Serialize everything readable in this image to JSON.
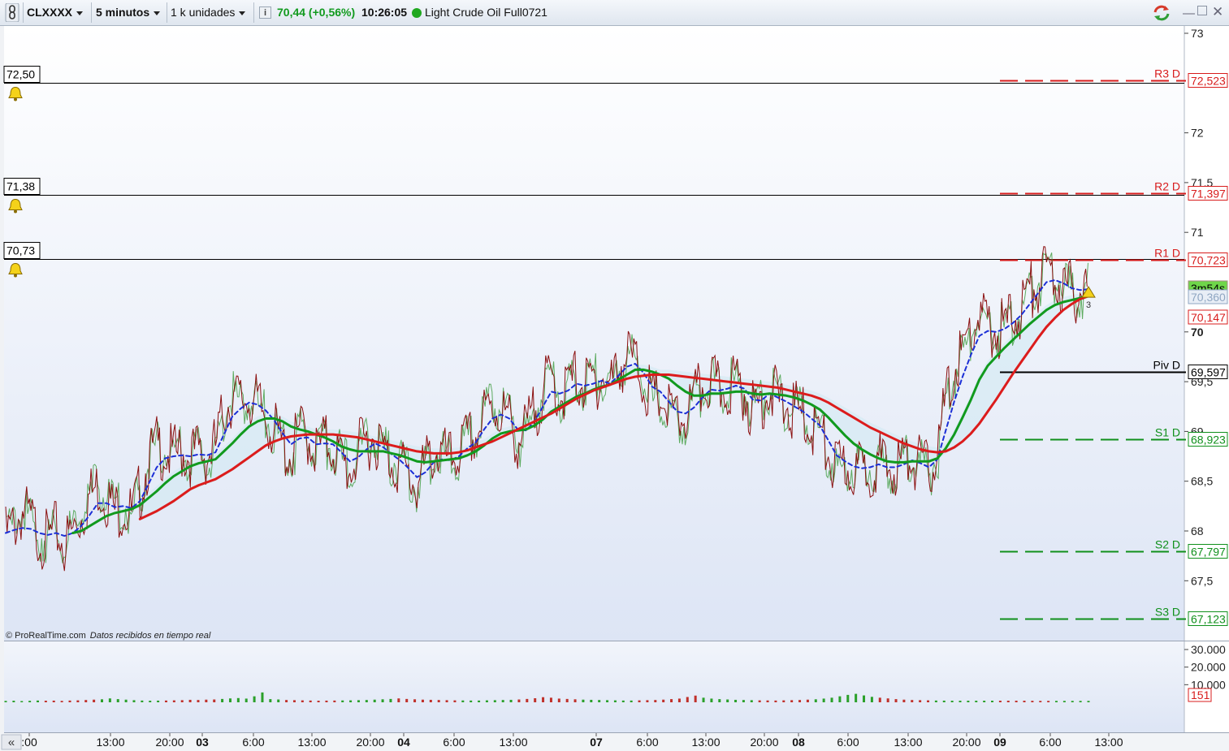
{
  "toolbar": {
    "symbol": "CLXXXX",
    "timeframe": "5 minutos",
    "units": "1 k unidades",
    "price": "70,44 (+0,56%)",
    "time": "10:26:05",
    "instrument": "Light Crude Oil Full0721"
  },
  "copyright": "© ProRealTime.com",
  "copyright_note": "Datos recibidos en tiempo real",
  "colors": {
    "price_line": "#8b1010",
    "fast_ma": "#1c2fd6",
    "medium_ma": "#119a1e",
    "slow_ma": "#dc1c1c",
    "resistance": "#d81c1c",
    "support": "#10901c",
    "pivot": "#000000",
    "background_top": "#ffffff",
    "background_bottom": "#dde5f5"
  },
  "icons": [
    "chain-link-icon",
    "info-icon",
    "status-dot-icon",
    "refresh-icon",
    "minimize-icon",
    "maximize-icon",
    "close-icon",
    "alert-bell-icon",
    "scroll-left-icon"
  ],
  "chart_data": {
    "type": "line",
    "title": "Light Crude Oil Full0721",
    "xlabel": "",
    "ylabel": "",
    "ylim": [
      66.7,
      73.1
    ],
    "grid": false,
    "y_ticks": [
      "73",
      "72",
      "71,5",
      "71",
      "70",
      "69,5",
      "69",
      "68,5",
      "68",
      "67,5"
    ],
    "x_ticks": [
      ":00",
      "13:00",
      "20:00",
      "03",
      "6:00",
      "13:00",
      "20:00",
      "04",
      "6:00",
      "13:00",
      "07",
      "6:00",
      "13:00",
      "20:00",
      "08",
      "6:00",
      "13:00",
      "20:00",
      "09",
      "6:00",
      "13:00"
    ],
    "x_ticks_bold": [
      "03",
      "04",
      "07",
      "08",
      "09"
    ],
    "series": [
      {
        "values": [
          67.95,
          68.05,
          68.2,
          68.1,
          67.95,
          67.9,
          68.0,
          67.85,
          68.0,
          68.15,
          68.35,
          68.45,
          68.35,
          68.2,
          68.25,
          68.15,
          68.4,
          68.7,
          68.85,
          68.8,
          68.75,
          68.8,
          68.75,
          68.8,
          68.75,
          68.85,
          69.2,
          69.35,
          69.3,
          69.35,
          69.25,
          69.15,
          69.0,
          68.85,
          68.75,
          69.0,
          68.95,
          68.8,
          68.9,
          68.85,
          68.7,
          68.6,
          68.8,
          68.9,
          68.95,
          68.8,
          68.7,
          68.65,
          68.55,
          68.45,
          68.65,
          68.8,
          68.75,
          68.7,
          68.8,
          68.9,
          68.95,
          69.15,
          69.25,
          69.2,
          69.1,
          68.9,
          69.0,
          69.2,
          69.4,
          69.55,
          69.35,
          69.45,
          69.55,
          69.45,
          69.5,
          69.55,
          69.45,
          69.65,
          69.75,
          69.7,
          69.5,
          69.3,
          69.35,
          69.2,
          69.1,
          69.15,
          69.3,
          69.45,
          69.5,
          69.4,
          69.45,
          69.5,
          69.4,
          69.2,
          69.3,
          69.45,
          69.3,
          69.25,
          69.2,
          69.15,
          69.05,
          69.0,
          68.75,
          68.6,
          68.65,
          68.6,
          68.6,
          68.65,
          68.7,
          68.6,
          68.65,
          68.7,
          68.75,
          68.65,
          68.6,
          68.8,
          69.3,
          69.6,
          69.8,
          70.0,
          70.15,
          70.05,
          70.0,
          70.05,
          70.15,
          70.25,
          70.4,
          70.5,
          70.6,
          70.55,
          70.45,
          70.4,
          70.4,
          70.45
        ]
      },
      {
        "values": [
          67.98,
          68.01,
          68.03,
          68.02,
          67.98,
          67.96,
          67.98,
          67.95,
          67.98,
          68.05,
          68.16,
          68.28,
          68.28,
          68.24,
          68.25,
          68.23,
          68.3,
          68.47,
          68.64,
          68.73,
          68.75,
          68.76,
          68.75,
          68.77,
          68.76,
          68.79,
          68.97,
          69.15,
          69.23,
          69.29,
          69.27,
          69.21,
          69.11,
          68.98,
          68.87,
          68.93,
          68.94,
          68.87,
          68.88,
          68.87,
          68.79,
          68.7,
          68.74,
          68.82,
          68.88,
          68.84,
          68.77,
          68.71,
          68.63,
          68.54,
          68.59,
          68.69,
          68.72,
          68.71,
          68.75,
          68.83,
          68.89,
          69.02,
          69.13,
          69.17,
          69.13,
          69.02,
          69.01,
          69.1,
          69.25,
          69.4,
          69.38,
          69.41,
          69.48,
          69.46,
          69.48,
          69.51,
          69.48,
          69.56,
          69.65,
          69.68,
          69.59,
          69.45,
          69.4,
          69.3,
          69.2,
          69.18,
          69.24,
          69.34,
          69.42,
          69.41,
          69.43,
          69.46,
          69.43,
          69.32,
          69.31,
          69.38,
          69.34,
          69.3,
          69.25,
          69.2,
          69.13,
          69.06,
          68.91,
          68.76,
          68.7,
          68.65,
          68.63,
          68.64,
          68.67,
          68.64,
          68.64,
          68.67,
          68.71,
          68.68,
          68.64,
          68.72,
          69.01,
          69.3,
          69.55,
          69.77,
          69.96,
          70.01,
          70.0,
          70.03,
          70.09,
          70.17,
          70.28,
          70.39,
          70.5,
          70.52,
          70.49,
          70.44,
          70.42,
          70.43
        ]
      },
      {
        "values": [
          null,
          null,
          null,
          null,
          null,
          null,
          null,
          null,
          67.98,
          68.0,
          68.05,
          68.1,
          68.15,
          68.18,
          68.2,
          68.22,
          68.26,
          68.33,
          68.4,
          68.48,
          68.55,
          68.6,
          68.65,
          68.68,
          68.7,
          68.72,
          68.8,
          68.88,
          68.97,
          69.05,
          69.1,
          69.13,
          69.13,
          69.1,
          69.05,
          69.02,
          69.0,
          68.97,
          68.94,
          68.9,
          68.85,
          68.82,
          68.8,
          68.8,
          68.8,
          68.8,
          68.78,
          68.76,
          68.73,
          68.7,
          68.69,
          68.7,
          68.71,
          68.72,
          68.73,
          68.76,
          68.8,
          68.86,
          68.93,
          68.98,
          69.0,
          69.01,
          69.02,
          69.06,
          69.12,
          69.2,
          69.25,
          69.3,
          69.35,
          69.38,
          69.42,
          69.45,
          69.47,
          69.52,
          69.57,
          69.62,
          69.62,
          69.6,
          69.57,
          69.53,
          69.46,
          69.4,
          69.36,
          69.36,
          69.38,
          69.38,
          69.39,
          69.4,
          69.4,
          69.38,
          69.37,
          69.38,
          69.37,
          69.36,
          69.34,
          69.31,
          69.27,
          69.22,
          69.14,
          69.05,
          68.96,
          68.88,
          68.82,
          68.77,
          68.73,
          68.7,
          68.69,
          68.69,
          68.7,
          68.7,
          68.7,
          68.73,
          68.83,
          68.97,
          69.14,
          69.32,
          69.52,
          69.66,
          69.75,
          69.84,
          69.92,
          70.0,
          70.08,
          70.15,
          70.22,
          70.27,
          70.3,
          70.32,
          70.34,
          70.36
        ]
      },
      {
        "values": [
          null,
          null,
          null,
          null,
          null,
          null,
          null,
          null,
          null,
          null,
          null,
          null,
          null,
          null,
          null,
          null,
          68.12,
          68.16,
          68.2,
          68.25,
          68.3,
          68.36,
          68.42,
          68.46,
          68.49,
          68.52,
          68.57,
          68.62,
          68.68,
          68.74,
          68.8,
          68.86,
          68.9,
          68.93,
          68.95,
          68.96,
          68.97,
          68.97,
          68.97,
          68.97,
          68.96,
          68.95,
          68.94,
          68.92,
          68.9,
          68.88,
          68.86,
          68.84,
          68.82,
          68.8,
          68.79,
          68.78,
          68.78,
          68.78,
          68.79,
          68.81,
          68.84,
          68.87,
          68.9,
          68.94,
          68.98,
          69.02,
          69.06,
          69.1,
          69.14,
          69.18,
          69.23,
          69.28,
          69.33,
          69.37,
          69.41,
          69.44,
          69.47,
          69.5,
          69.53,
          69.55,
          69.56,
          69.57,
          69.57,
          69.57,
          69.56,
          69.55,
          69.54,
          69.53,
          69.52,
          69.51,
          69.5,
          69.49,
          69.48,
          69.47,
          69.46,
          69.45,
          69.44,
          69.42,
          69.4,
          69.38,
          69.36,
          69.33,
          69.29,
          69.24,
          69.19,
          69.14,
          69.09,
          69.04,
          69.0,
          68.96,
          68.92,
          68.88,
          68.85,
          68.82,
          68.8,
          68.79,
          68.8,
          68.84,
          68.9,
          68.98,
          69.08,
          69.2,
          69.32,
          69.45,
          69.58,
          69.7,
          69.82,
          69.94,
          70.05,
          70.14,
          70.22,
          70.28,
          70.33,
          70.36
        ]
      }
    ],
    "series_meta": [
      {
        "style": "line",
        "width": 1,
        "color": "#8b1010"
      },
      {
        "style": "dashed",
        "width": 2,
        "color": "#1c2fd6"
      },
      {
        "style": "line",
        "width": 3,
        "color": "#119a1e"
      },
      {
        "style": "line",
        "width": 3,
        "color": "#dc1c1c"
      }
    ],
    "horizontal_lines": [
      {
        "name": "R3 D",
        "value": 72.523,
        "label": "72,523",
        "color": "#d81c1c",
        "style": "dashed"
      },
      {
        "name": "R2 D",
        "value": 71.397,
        "label": "71,397",
        "color": "#d81c1c",
        "style": "dashed"
      },
      {
        "name": "R1 D",
        "value": 70.723,
        "label": "70,723",
        "color": "#d81c1c",
        "style": "dashed"
      },
      {
        "name": "Piv D",
        "value": 69.597,
        "label": "69,597",
        "color": "#000000",
        "style": "solid"
      },
      {
        "name": "S1 D",
        "value": 68.923,
        "label": "68,923",
        "color": "#10901c",
        "style": "dashed"
      },
      {
        "name": "S2 D",
        "value": 67.797,
        "label": "67,797",
        "color": "#10901c",
        "style": "dashed"
      },
      {
        "name": "S3 D",
        "value": 67.123,
        "label": "67,123",
        "color": "#10901c",
        "style": "dashed"
      }
    ],
    "alert_lines": [
      {
        "value": 72.5,
        "label": "72,50"
      },
      {
        "value": 71.38,
        "label": "71,38"
      },
      {
        "value": 70.73,
        "label": "70,73"
      }
    ],
    "price_tags": [
      {
        "value": 70.44,
        "label": "70,44",
        "bg": "#f2d21b",
        "color": "#000000"
      },
      {
        "value": 70.4,
        "label": "3m54s",
        "bg": "#6fd64a",
        "color": "#000000"
      },
      {
        "value": 70.36,
        "label": "70,360",
        "bg": "#e8eef6",
        "color": "#8fa6c2"
      },
      {
        "value": 70.147,
        "label": "70,147",
        "bg": "#ffffff",
        "color": "#d81c1c"
      }
    ],
    "alert_marker": {
      "label": "3"
    },
    "bold_tick": "70",
    "volume": {
      "ylim": [
        0,
        32000
      ],
      "y_ticks": [
        "30.000",
        "20.000",
        "10.000"
      ],
      "last_label": "151",
      "values": [
        800,
        900,
        700,
        850,
        1000,
        900,
        950,
        800,
        1000,
        1100,
        1300,
        1500,
        1700,
        2200,
        1800,
        1500,
        1200,
        1000,
        900,
        950,
        1000,
        1100,
        1200,
        1400,
        1300,
        1500,
        1600,
        1900,
        2200,
        2400,
        2100,
        3400,
        5600,
        1800,
        1600,
        1300,
        1200,
        1100,
        1000,
        900,
        950,
        1000,
        1050,
        1100,
        1200,
        1300,
        1500,
        1700,
        1900,
        2200,
        1900,
        1700,
        1500,
        1400,
        1300,
        1200,
        1100,
        1050,
        1000,
        1000,
        1100,
        1200,
        1300,
        1400,
        1600,
        1900,
        2300,
        2900,
        2600,
        2100,
        1900,
        1700,
        1500,
        1400,
        1300,
        1200,
        1100,
        1000,
        1000,
        1100,
        1200,
        1300,
        1500,
        1800,
        2100,
        3000,
        3800,
        2600,
        2100,
        1800,
        1600,
        1400,
        1300,
        1200,
        1100,
        1050,
        1000,
        1100,
        1200,
        1300,
        1500,
        1700,
        2100,
        2600,
        3400,
        4200,
        4800,
        3900,
        3100,
        2600,
        2200,
        1800,
        1500,
        1300,
        1200,
        1100,
        1000,
        950,
        900,
        900,
        900,
        900,
        900,
        900,
        900,
        900,
        900,
        900,
        850,
        800,
        800,
        800,
        800,
        800,
        800,
        800
      ]
    }
  }
}
